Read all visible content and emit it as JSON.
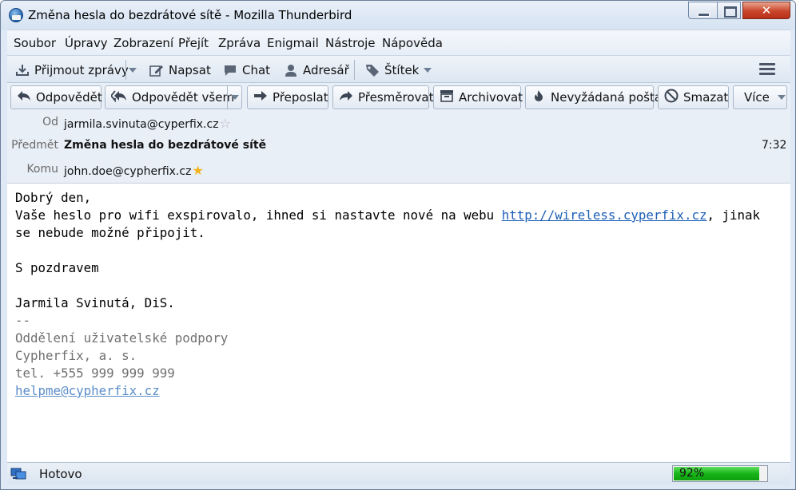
{
  "window": {
    "title": "Změna hesla do bezdrátové sítě - Mozilla Thunderbird",
    "close_glyph": "✕"
  },
  "menu": {
    "items": [
      "Soubor",
      "Úpravy",
      "Zobrazení",
      "Přejít",
      "Zpráva",
      "Enigmail",
      "Nástroje",
      "Nápověda"
    ]
  },
  "toolbar": {
    "get_messages": "Přijmout zprávy",
    "write": "Napsat",
    "chat": "Chat",
    "address_book": "Adresář",
    "tag": "Štítek",
    "menu_icon": "hamburger-icon"
  },
  "actions": {
    "reply": "Odpovědět",
    "reply_all": "Odpovědět všem",
    "forward": "Přeposlat",
    "redirect": "Přesměrovat",
    "archive": "Archivovat",
    "junk": "Nevyžádaná pošta",
    "delete": "Smazat",
    "more": "Více"
  },
  "header": {
    "from_label": "Od",
    "from_value": "jarmila.svinuta@cyperfix.cz",
    "subject_label": "Předmět",
    "subject_value": "Změna hesla do bezdrátové sítě",
    "time": "7:32",
    "to_label": "Komu",
    "to_value": "john.doe@cypherfix.cz"
  },
  "body": {
    "greeting": "Dobrý den,",
    "line1_before_link": "Vaše heslo pro wifi exspirovalo, ihned si nastavte nové na webu ",
    "link": "http://wireless.cyperfix.cz",
    "line1_after_link": ", jinak",
    "line2": "se nebude možné připojit.",
    "closing": "S pozdravem",
    "name": "Jarmila Svinutá, DiS.",
    "sig_separator": "--",
    "sig_department": "Oddělení uživatelské podpory",
    "sig_company": "Cypherfix, a. s.",
    "sig_phone": "tel. +555 999 999 999",
    "sig_email": "helpme@cypherfix.cz"
  },
  "status": {
    "text": "Hotovo",
    "progress_label": "92%",
    "progress_value": 0.92
  },
  "colors": {
    "link": "#1c5fb5",
    "progress": "#18b418",
    "star_filled": "#f2b21c"
  }
}
